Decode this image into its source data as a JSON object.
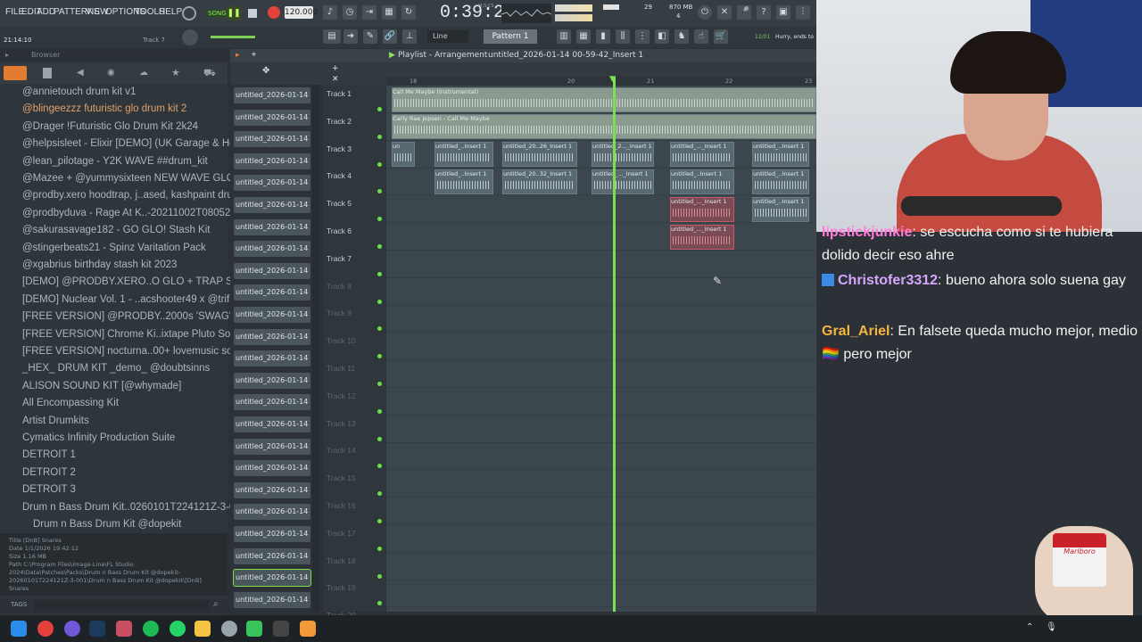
{
  "menu": [
    "FILE",
    "EDIT",
    "ADD",
    "PATTERNS",
    "VIEW",
    "OPTIONS",
    "TOOLS",
    "HELP"
  ],
  "transport": {
    "song_label": "SONG",
    "tempo": "120.000",
    "time": "0:39:21",
    "time_sub": "M:S:CS",
    "cpu": "29",
    "ram": "870 MB",
    "voices": "4"
  },
  "toolbar": {
    "position": "21:14:10",
    "track_label": "Track 7",
    "snap": "Line",
    "pattern": "Pattern 1",
    "hint_num": "12/01",
    "hint": "Hurry, ends to"
  },
  "browser": {
    "title": "Browser",
    "items": [
      {
        "label": "@annietouch drum kit v1",
        "orange": false
      },
      {
        "label": "@blingeezzz futuristic glo drum kit 2",
        "orange": true
      },
      {
        "label": "@Drager !Futuristic Glo Drum Kit 2k24",
        "orange": false
      },
      {
        "label": "@helpsisleet - Elixir [DEMO] (UK Garage & House)",
        "orange": false
      },
      {
        "label": "@lean_pilotage - Y2K WAVE ##drum_kit",
        "orange": false
      },
      {
        "label": "@Mazee + @yummysixteen NEW WAVE GLO kit",
        "orange": false
      },
      {
        "label": "@prodby.xero hoodtrap, j..ased, kashpaint drum kit",
        "orange": false
      },
      {
        "label": "@prodbyduva - Rage At K..-20211002T080527Z-001",
        "orange": false
      },
      {
        "label": "@sakurasavage182 - GO GLO! Stash Kit",
        "orange": false
      },
      {
        "label": "@stingerbeats21 - Spinz Varitation Pack",
        "orange": false
      },
      {
        "label": "@xgabrius birthday stash kit 2023",
        "orange": false
      },
      {
        "label": "[DEMO] @PRODBY.XERO..O GLO + TRAP SOUND KIT",
        "orange": false
      },
      {
        "label": "[DEMO] Nuclear Vol. 1 - ..acshooter49 x @trifreeze",
        "orange": false
      },
      {
        "label": "[FREE VERSION] @PRODBY..2000s 'SWAG' Drum Kit",
        "orange": false
      },
      {
        "label": "[FREE VERSION] Chrome Ki..ixtape Pluto Sound Kit",
        "orange": false
      },
      {
        "label": "[FREE VERSION] nocturna..00+ lovemusic sound kit",
        "orange": false
      },
      {
        "label": "_HEX_ DRUM KIT _demo_ @doubtsinns",
        "orange": false
      },
      {
        "label": "ALISON SOUND KIT [@whymade]",
        "orange": false
      },
      {
        "label": "All Encompassing Kit",
        "orange": false
      },
      {
        "label": "Artist Drumkits",
        "orange": false
      },
      {
        "label": "Cymatics Infinity Production Suite",
        "orange": false
      },
      {
        "label": "DETROIT 1",
        "orange": false
      },
      {
        "label": "DETROIT 2",
        "orange": false
      },
      {
        "label": "DETROIT 3",
        "orange": false
      },
      {
        "label": "Drum n Bass Drum Kit..0260101T224121Z-3-001",
        "orange": false
      },
      {
        "label": "Drum n Bass Drum Kit @dopekit",
        "orange": false
      }
    ],
    "info": {
      "title": "Title    [DnB] Snares",
      "date": "Date     1/1/2026 19:42:12",
      "size": "Size     1.16 MB",
      "path": "Path     C:\\Program Files\\Image-Line\\FL Studio 2024\\Data\\Patches\\Packs\\Drum n Bass Drum Kit @dopekit-20260101T224121Z-3-001\\Drum n Bass Drum Kit @dopekit\\[DnB] Snares"
    },
    "tags_label": "TAGS"
  },
  "patterns": [
    "untitled_2026-01-14 00-",
    "untitled_2026-01-14 00-",
    "untitled_2026-01-14 00-",
    "untitled_2026-01-14 00-",
    "untitled_2026-01-14 00-",
    "untitled_2026-01-14 00-",
    "untitled_2026-01-14 00-",
    "untitled_2026-01-14 00-",
    "untitled_2026-01-14 00-",
    "untitled_2026-01-14 00-",
    "untitled_2026-01-14 00-",
    "untitled_2026-01-14 00-",
    "untitled_2026-01-14 00-",
    "untitled_2026-01-14 00-",
    "untitled_2026-01-14 00-",
    "untitled_2026-01-14 00-",
    "untitled_2026-01-14 00-",
    "untitled_2026-01-14 00-",
    "untitled_2026-01-14 00-",
    "untitled_2026-01-14 00-",
    "untitled_2026-01-14 00-",
    "untitled_2026-01-14 00-",
    "untitled_2026-01-14 00-",
    "untitled_2026-01-14 00-"
  ],
  "playlist": {
    "title": "Playlist - Arrangement",
    "sub": "untitled_2026-01-14 00-59-42_Insert 1",
    "ruler": [
      "18",
      "",
      "20",
      "21",
      "22",
      "23"
    ],
    "tracks": [
      "Track 1",
      "Track 2",
      "Track 3",
      "Track 4",
      "Track 5",
      "Track 6",
      "Track 7",
      "Track 8",
      "Track 9",
      "Track 10",
      "Track 11",
      "Track 12",
      "Track 13",
      "Track 14",
      "Track 15",
      "Track 16",
      "Track 17",
      "Track 18",
      "Track 19",
      "Track 20"
    ],
    "clips": {
      "t1": "Call Me Maybe (Instrumental)",
      "t2": "Carly Rae Jepsen - Call Me Maybe",
      "t3": [
        "un",
        "untitled_..Insert 1",
        "untitled_20..26_Insert 1",
        "untitled_2..._Insert 1",
        "untitled_..._Insert 1",
        "untitled_..Insert 1"
      ],
      "t4": [
        "untitled_..Insert 1",
        "untitled_20..32_Insert 1",
        "untitled_..._Insert 1",
        "untitled_..Insert 1",
        "untitled_..Insert 1"
      ],
      "t5": [
        "untitled_..._Insert 1",
        "untitled_..Insert 1"
      ],
      "t6": [
        "untitled_..._Insert 1"
      ]
    }
  },
  "chat": [
    {
      "user": "lipstickjunkie",
      "color": "#ff7ad9",
      "text": ": se escucha como si te hubiera dolido decir eso ahre"
    },
    {
      "user": "Christofer3312",
      "color": "#d6a6ff",
      "text": ": bueno ahora solo suena gay"
    },
    {
      "user": "Gral_Ariel",
      "color": "#f4b63c",
      "text": ": En falsete queda mucho mejor, medio 🏳️‍🌈 pero mejor"
    }
  ],
  "pack_text": "Marlboro",
  "icons": [
    "windows-start-icon",
    "chrome-icon",
    "discord-icon",
    "steam-icon",
    "spotify-icon",
    "whatsapp-icon",
    "folder-icon",
    "fl-studio-icon"
  ],
  "colors": {
    "accent_green": "#7ce04d",
    "clip_red": "#c45a6a",
    "record_red": "#e0443c"
  }
}
